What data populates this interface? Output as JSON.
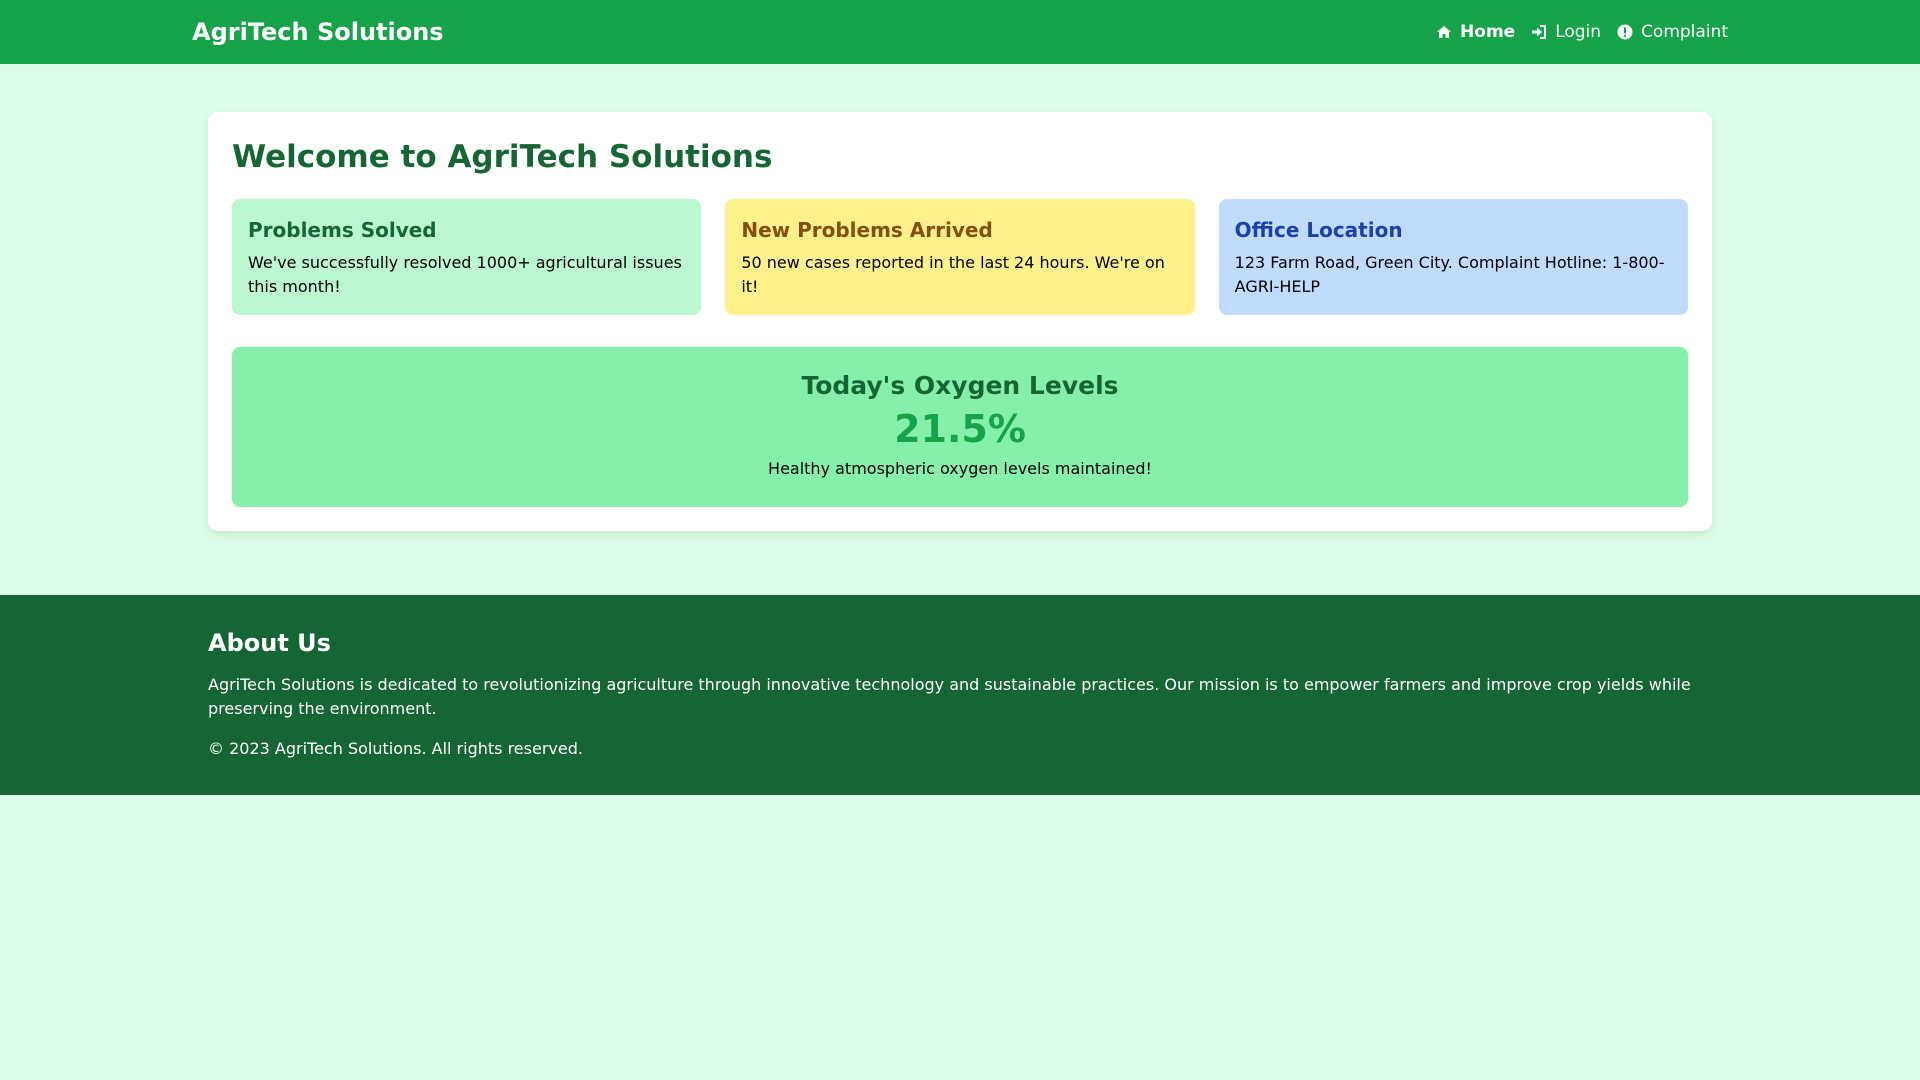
{
  "header": {
    "brand": "AgriTech Solutions",
    "nav": [
      {
        "label": "Home",
        "icon": "home-icon",
        "active": true
      },
      {
        "label": "Login",
        "icon": "login-icon",
        "active": false
      },
      {
        "label": "Complaint",
        "icon": "info-icon",
        "active": false
      }
    ]
  },
  "main": {
    "title": "Welcome to AgriTech Solutions",
    "cards": [
      {
        "title": "Problems Solved",
        "text": "We've successfully resolved 1000+ agricultural issues this month!"
      },
      {
        "title": "New Problems Arrived",
        "text": "50 new cases reported in the last 24 hours. We're on it!"
      },
      {
        "title": "Office Location",
        "text": "123 Farm Road, Green City. Complaint Hotline: 1-800-AGRI-HELP"
      }
    ],
    "oxygen": {
      "title": "Today's Oxygen Levels",
      "value": "21.5%",
      "note": "Healthy atmospheric oxygen levels maintained!"
    }
  },
  "footer": {
    "title": "About Us",
    "about": "AgriTech Solutions is dedicated to revolutionizing agriculture through innovative technology and sustainable practices. Our mission is to empower farmers and improve crop yields while preserving the environment.",
    "copyright": "© 2023 AgriTech Solutions. All rights reserved."
  },
  "colors": {
    "primary": "#16a34a",
    "dark_green": "#166534",
    "page_bg": "#dcfce7",
    "card_green": "#bbf7d0",
    "card_yellow": "#fef08a",
    "card_blue": "#bfdbfe",
    "oxygen_bg": "#86efac"
  }
}
